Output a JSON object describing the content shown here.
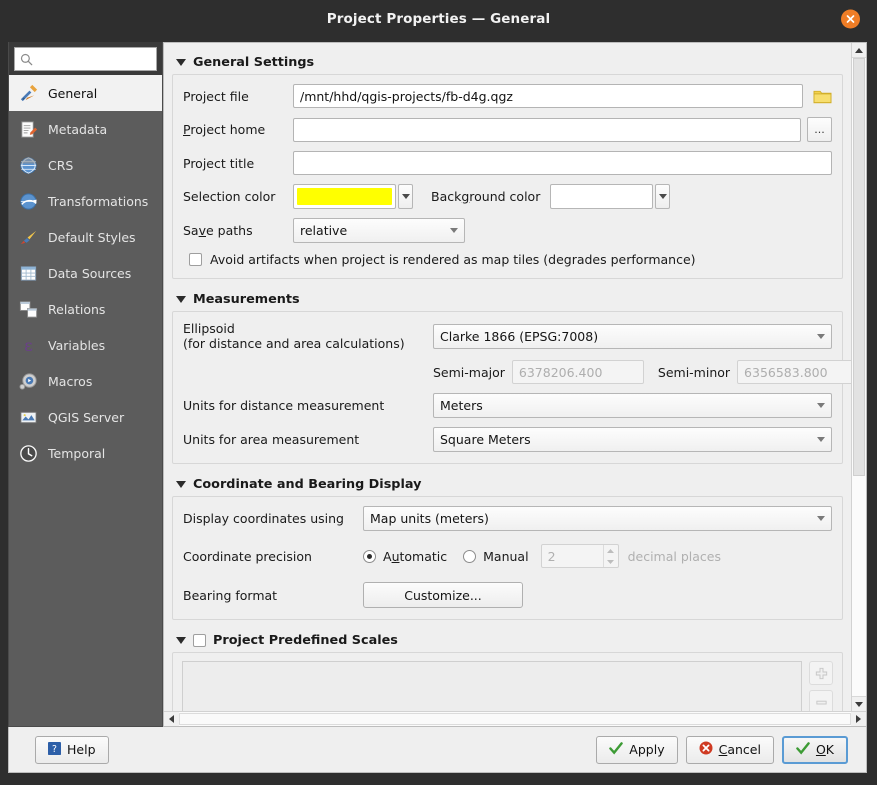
{
  "window": {
    "title": "Project Properties — General",
    "close_label": "✕"
  },
  "sidebar": {
    "search_placeholder": "",
    "search_value": "",
    "items": [
      {
        "label": "General",
        "icon": "hammer-wrench-icon",
        "selected": true
      },
      {
        "label": "Metadata",
        "icon": "document-pencil-icon",
        "selected": false
      },
      {
        "label": "CRS",
        "icon": "globe-icon",
        "selected": false
      },
      {
        "label": "Transformations",
        "icon": "globe-arrow-icon",
        "selected": false
      },
      {
        "label": "Default Styles",
        "icon": "paintbrush-icon",
        "selected": false
      },
      {
        "label": "Data Sources",
        "icon": "table-icon",
        "selected": false
      },
      {
        "label": "Relations",
        "icon": "relations-icon",
        "selected": false
      },
      {
        "label": "Variables",
        "icon": "epsilon-icon",
        "selected": false
      },
      {
        "label": "Macros",
        "icon": "gear-play-icon",
        "selected": false
      },
      {
        "label": "QGIS Server",
        "icon": "server-map-icon",
        "selected": false
      },
      {
        "label": "Temporal",
        "icon": "clock-icon",
        "selected": false
      }
    ]
  },
  "general_settings": {
    "title": "General Settings",
    "project_file_label": "Project file",
    "project_file_value": "/mnt/hhd/qgis-projects/fb-d4g.qgz",
    "project_file_browse": "folder-icon",
    "project_home_label": "Project home",
    "project_home_value": "",
    "project_home_browse": "...",
    "project_title_label": "Project title",
    "project_title_value": "",
    "selection_color_label": "Selection color",
    "selection_color_value": "#FFFF00",
    "background_color_label": "Background color",
    "background_color_value": "#FFFFFF",
    "save_paths_label": "Save paths",
    "save_paths_value": "relative",
    "avoid_artifacts_label": "Avoid artifacts when project is rendered as map tiles (degrades performance)",
    "avoid_artifacts_checked": false
  },
  "measurements": {
    "title": "Measurements",
    "ellipsoid_label_line1": "Ellipsoid",
    "ellipsoid_label_line2": "(for distance and area calculations)",
    "ellipsoid_value": "Clarke 1866 (EPSG:7008)",
    "semi_major_label": "Semi-major",
    "semi_major_value": "6378206.400",
    "semi_minor_label": "Semi-minor",
    "semi_minor_value": "6356583.800",
    "distance_units_label": "Units for distance measurement",
    "distance_units_value": "Meters",
    "area_units_label": "Units for area measurement",
    "area_units_value": "Square Meters"
  },
  "coordinate_display": {
    "title": "Coordinate and Bearing Display",
    "display_coords_label": "Display coordinates using",
    "display_coords_value": "Map units (meters)",
    "precision_label": "Coordinate precision",
    "automatic_label": "Automatic",
    "automatic_selected": true,
    "manual_label": "Manual",
    "manual_selected": false,
    "decimals_value": "2",
    "decimals_suffix": "decimal places",
    "bearing_format_label": "Bearing format",
    "customize_button": "Customize..."
  },
  "predefined_scales": {
    "title": "Project Predefined Scales",
    "checked": false,
    "items": [],
    "add_button": "add-icon",
    "remove_button": "remove-icon",
    "import_button": "folder-icon"
  },
  "footer": {
    "help_label": "Help",
    "apply_label": "Apply",
    "cancel_label": "Cancel",
    "ok_label": "OK"
  },
  "colors": {
    "titlebar_bg": "#2e2e2e",
    "sidebar_bg": "#5c5c5c",
    "panel_bg": "#efefef",
    "accent_close": "#ef7d26",
    "focus_border": "#5a9bd4"
  }
}
